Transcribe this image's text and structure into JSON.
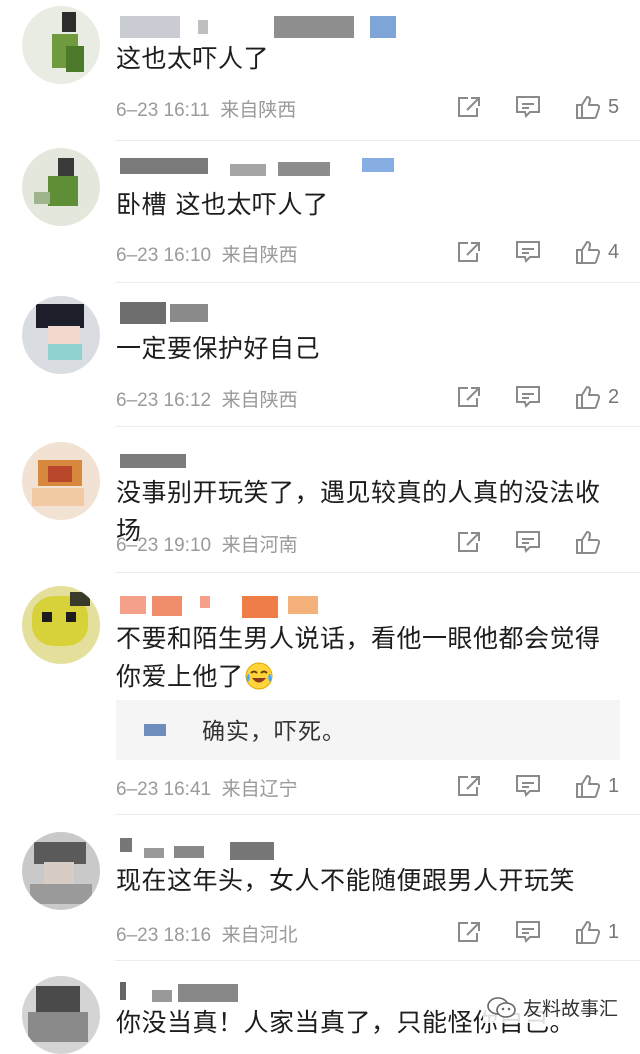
{
  "comments": [
    {
      "text": "这也太吓人了",
      "time": "6–23 16:11",
      "location": "来自陕西",
      "likes": "5"
    },
    {
      "text": "卧槽  这也太吓人了",
      "time": "6–23 16:10",
      "location": "来自陕西",
      "likes": "4"
    },
    {
      "text": "一定要保护好自己",
      "time": "6–23 16:12",
      "location": "来自陕西",
      "likes": "2"
    },
    {
      "text": "没事别开玩笑了，遇见较真的人真的没法收场",
      "time": "6–23 19:10",
      "location": "来自河南",
      "likes": ""
    },
    {
      "text": "不要和陌生男人说话，看他一眼他都会觉得你爱上他了",
      "time": "6–23 16:41",
      "location": "来自辽宁",
      "likes": "1",
      "reply": {
        "text": "确实，吓死。"
      }
    },
    {
      "text": "现在这年头，女人不能随便跟男人开玩笑",
      "time": "6–23 18:16",
      "location": "来自河北",
      "likes": "1"
    },
    {
      "text": "你没当真！人家当真了，只能怪你自己。"
    }
  ],
  "watermark": {
    "text": "友料故事汇"
  },
  "icons": {
    "share": "share-icon",
    "comment": "comment-icon",
    "like": "thumbs-up-icon",
    "emoji": "laugh-cry-emoji-icon",
    "wechat": "wechat-icon"
  },
  "colors": {
    "meta": "#9a9a9a",
    "icon": "#8a8a8a",
    "reply_bg": "#f5f5f5"
  }
}
